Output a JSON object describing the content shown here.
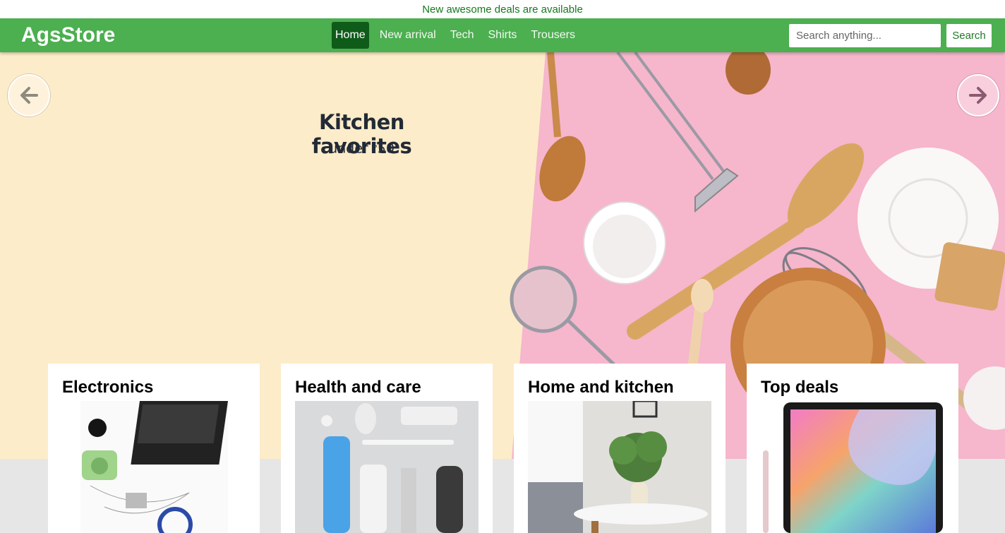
{
  "announcement": "New awesome deals are available",
  "brand": "AgsStore",
  "nav": {
    "items": [
      {
        "label": "Home",
        "active": true
      },
      {
        "label": "New arrival",
        "active": false
      },
      {
        "label": "Tech",
        "active": false
      },
      {
        "label": "Shirts",
        "active": false
      },
      {
        "label": "Trousers",
        "active": false
      }
    ]
  },
  "search": {
    "placeholder": "Search anything...",
    "button_label": "Search"
  },
  "hero": {
    "title": "Kitchen favorites",
    "subtitle_prefix": "under ",
    "subtitle_currency": "$",
    "subtitle_amount": "50",
    "prev_icon": "arrow-left-icon",
    "next_icon": "arrow-right-icon"
  },
  "categories": [
    {
      "title": "Electronics",
      "image": "electronics-image"
    },
    {
      "title": "Health and care",
      "image": "health-care-image"
    },
    {
      "title": "Home and kitchen",
      "image": "home-kitchen-image"
    },
    {
      "title": "Top deals",
      "image": "tablet-image"
    }
  ],
  "colors": {
    "navbar": "#4caf50",
    "announcement_text": "#137a1b",
    "active_nav": "#0f5b1a",
    "hero_left": "#fdecc9",
    "hero_right": "#f6b6cc"
  }
}
